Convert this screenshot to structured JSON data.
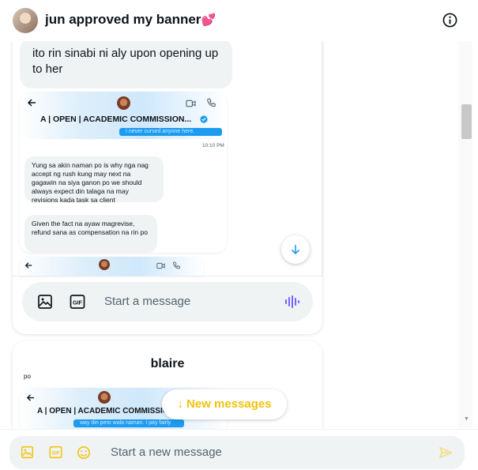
{
  "header": {
    "title": "jun approved my banner",
    "title_emoji": "💕"
  },
  "chat_embed": {
    "message_text": "ito rin sinabi ni aly upon opening up to her",
    "screenshot_1": {
      "contact_name": "A | OPEN | ACADEMIC COMMISSION...",
      "sent_snippet": "I never cursed anyone here.",
      "sent_time": "10:10 PM",
      "received_1": "Yung sa akin naman po is why nga nag accept ng rush kung may next na gagawin na siya ganon po we should always expect din talaga na may revisions kada task sa client",
      "received_2": "Given the fact na ayaw magrevise, refund sana as compensation na rin po"
    },
    "composer_placeholder": "Start a message"
  },
  "blaire_card": {
    "name": "blaire",
    "screenshot_2": {
      "contact_name": "A | OPEN | ACADEMIC COMMISSION...",
      "sent_snippet": "way din pero wala naman. I pay fairly"
    }
  },
  "new_messages_label": "↓ New messages",
  "bottom_composer": {
    "placeholder": "Start a new message"
  },
  "colors": {
    "accent_yellow": "#f4c20d",
    "twitter_blue": "#1d9bf0",
    "mic_purple": "#7b61ff"
  },
  "icons": [
    "info-icon",
    "back-arrow-icon",
    "video-icon",
    "phone-icon",
    "verified-icon",
    "arrow-down-icon",
    "image-icon",
    "gif-icon",
    "mic-waveform-icon",
    "emoji-icon",
    "send-icon"
  ]
}
